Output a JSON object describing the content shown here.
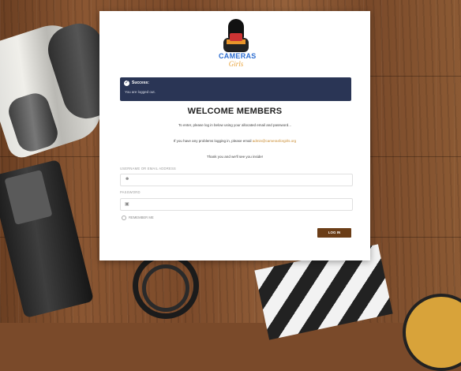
{
  "brand": {
    "line1": "CAMERAS",
    "line2": "Girls"
  },
  "alert": {
    "title": "Success:",
    "message": "You are logged out."
  },
  "welcome": "WELCOME MEMBERS",
  "paragraphs": {
    "p1": "To enter, please log in below using your allocated email and password...",
    "p2_prefix": "If you have any problems logging in, please email ",
    "p2_email": "admin@camerasforgirls.org",
    "p3": "Thank you and we'll see you inside!"
  },
  "form": {
    "username_label": "USERNAME OR EMAIL ADDRESS",
    "password_label": "PASSWORD",
    "remember_label": "REMEMBER ME",
    "login_button": "LOG IN",
    "user_icon": "user-icon",
    "lock_icon": "lock-icon"
  },
  "colors": {
    "alert_bg": "#2a3555",
    "button_bg": "#6b3d17",
    "link": "#c98a2e"
  }
}
